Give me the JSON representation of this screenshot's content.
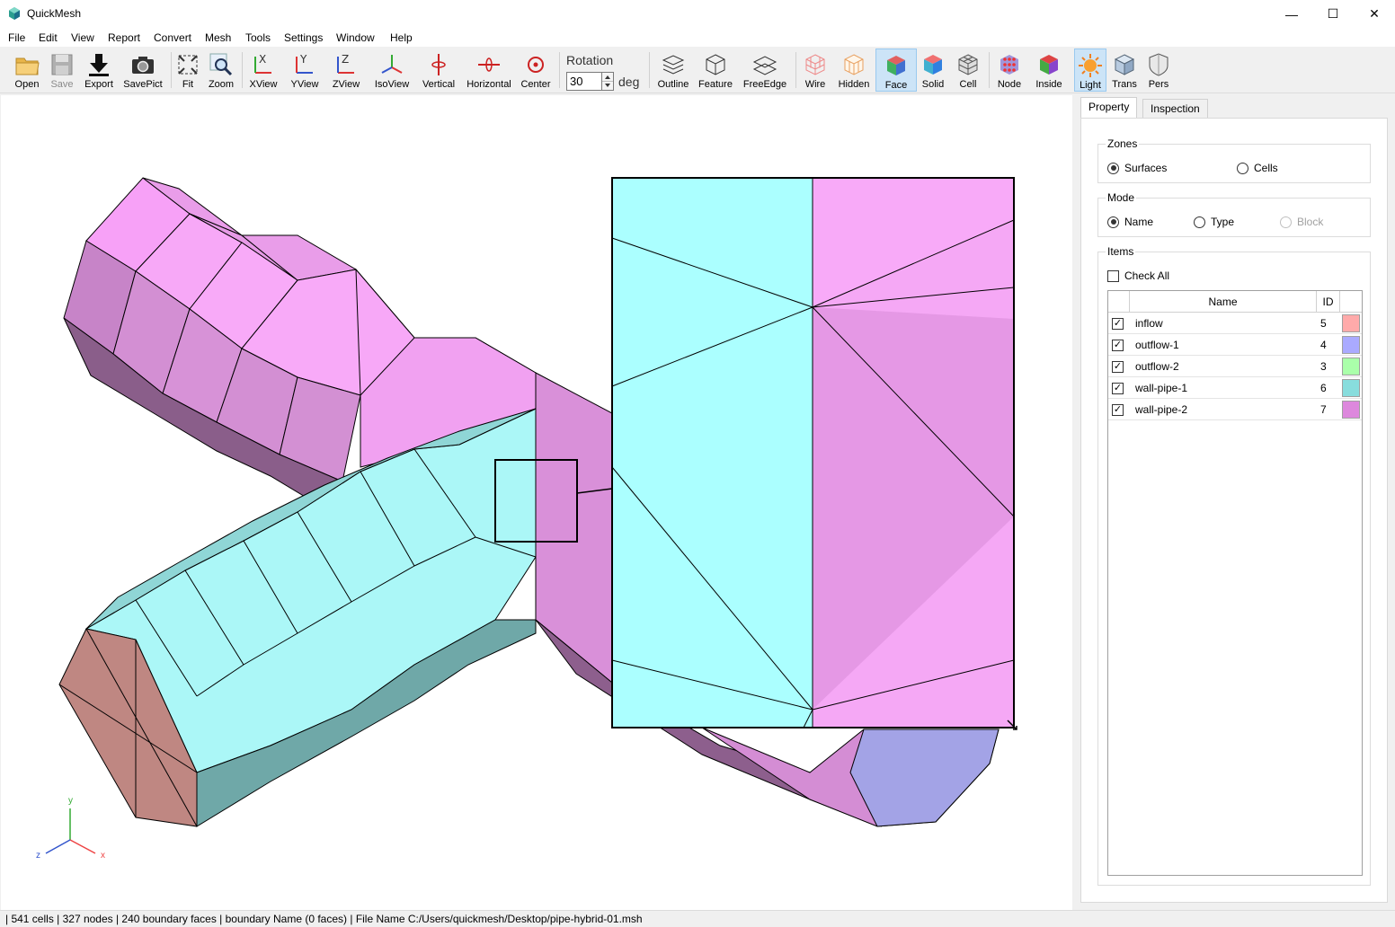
{
  "app": {
    "title": "QuickMesh"
  },
  "window_controls": {
    "minimize": "—",
    "maximize": "☐",
    "close": "✕"
  },
  "menu": [
    "File",
    "Edit",
    "View",
    "Report",
    "Convert",
    "Mesh",
    "Tools",
    "Settings",
    "Window",
    "Help"
  ],
  "toolbar": {
    "buttons": [
      {
        "label": "Open",
        "icon": "folder-open-icon"
      },
      {
        "label": "Save",
        "icon": "save-disk-icon",
        "disabled": true
      },
      {
        "label": "Export",
        "icon": "download-arrow-icon"
      },
      {
        "label": "SavePict",
        "icon": "camera-icon"
      },
      {
        "label": "Fit",
        "icon": "fit-view-icon"
      },
      {
        "label": "Zoom",
        "icon": "zoom-icon"
      },
      {
        "label": "XView",
        "icon": "x-view-axes-icon"
      },
      {
        "label": "YView",
        "icon": "y-view-axes-icon"
      },
      {
        "label": "ZView",
        "icon": "z-view-axes-icon"
      },
      {
        "label": "IsoView",
        "icon": "iso-view-axes-icon"
      },
      {
        "label": "Vertical",
        "icon": "rotate-vertical-icon"
      },
      {
        "label": "Horizontal",
        "icon": "rotate-horizontal-icon"
      },
      {
        "label": "Center",
        "icon": "rotate-center-icon"
      },
      {
        "label": "Outline",
        "icon": "outline-layers-icon"
      },
      {
        "label": "Feature",
        "icon": "feature-cube-icon"
      },
      {
        "label": "FreeEdge",
        "icon": "free-edge-icon"
      },
      {
        "label": "Wire",
        "icon": "wire-cube-icon"
      },
      {
        "label": "Hidden",
        "icon": "hidden-line-cube-icon"
      },
      {
        "label": "Face",
        "icon": "face-cube-icon",
        "active": true
      },
      {
        "label": "Solid",
        "icon": "solid-cube-icon"
      },
      {
        "label": "Cell",
        "icon": "cell-mesh-icon"
      },
      {
        "label": "Node",
        "icon": "node-grid-icon"
      },
      {
        "label": "Inside",
        "icon": "inside-hex-icon"
      },
      {
        "label": "Light",
        "icon": "light-sun-icon",
        "active": true
      },
      {
        "label": "Trans",
        "icon": "transparent-cube-icon"
      },
      {
        "label": "Pers",
        "icon": "perspective-shield-icon"
      }
    ],
    "rotation": {
      "label": "Rotation",
      "value": "30",
      "unit": "deg"
    }
  },
  "viewport": {
    "axis_labels": {
      "y": "y",
      "z": "z",
      "x": "x"
    }
  },
  "panel": {
    "tabs": [
      "Property",
      "Inspection"
    ],
    "zones": {
      "title": "Zones",
      "options": [
        {
          "label": "Surfaces",
          "checked": true
        },
        {
          "label": "Cells",
          "checked": false
        }
      ]
    },
    "mode": {
      "title": "Mode",
      "options": [
        {
          "label": "Name",
          "checked": true
        },
        {
          "label": "Type",
          "checked": false
        },
        {
          "label": "Block",
          "checked": false,
          "disabled": true
        }
      ]
    },
    "items": {
      "title": "Items",
      "check_all": "Check All",
      "columns": {
        "name": "Name",
        "id": "ID"
      },
      "rows": [
        {
          "name": "inflow",
          "id": "5",
          "color": "#ffaaaa",
          "checked": true
        },
        {
          "name": "outflow-1",
          "id": "4",
          "color": "#aaaaff",
          "checked": true
        },
        {
          "name": "outflow-2",
          "id": "3",
          "color": "#aaffaa",
          "checked": true
        },
        {
          "name": "wall-pipe-1",
          "id": "6",
          "color": "#88dddd",
          "checked": true
        },
        {
          "name": "wall-pipe-2",
          "id": "7",
          "color": "#dd88dd",
          "checked": true
        }
      ]
    }
  },
  "status": "| 541 cells | 327 nodes | 240 boundary faces |  boundary Name  (0 faces) | File Name C:/Users/quickmesh/Desktop/pipe-hybrid-01.msh"
}
